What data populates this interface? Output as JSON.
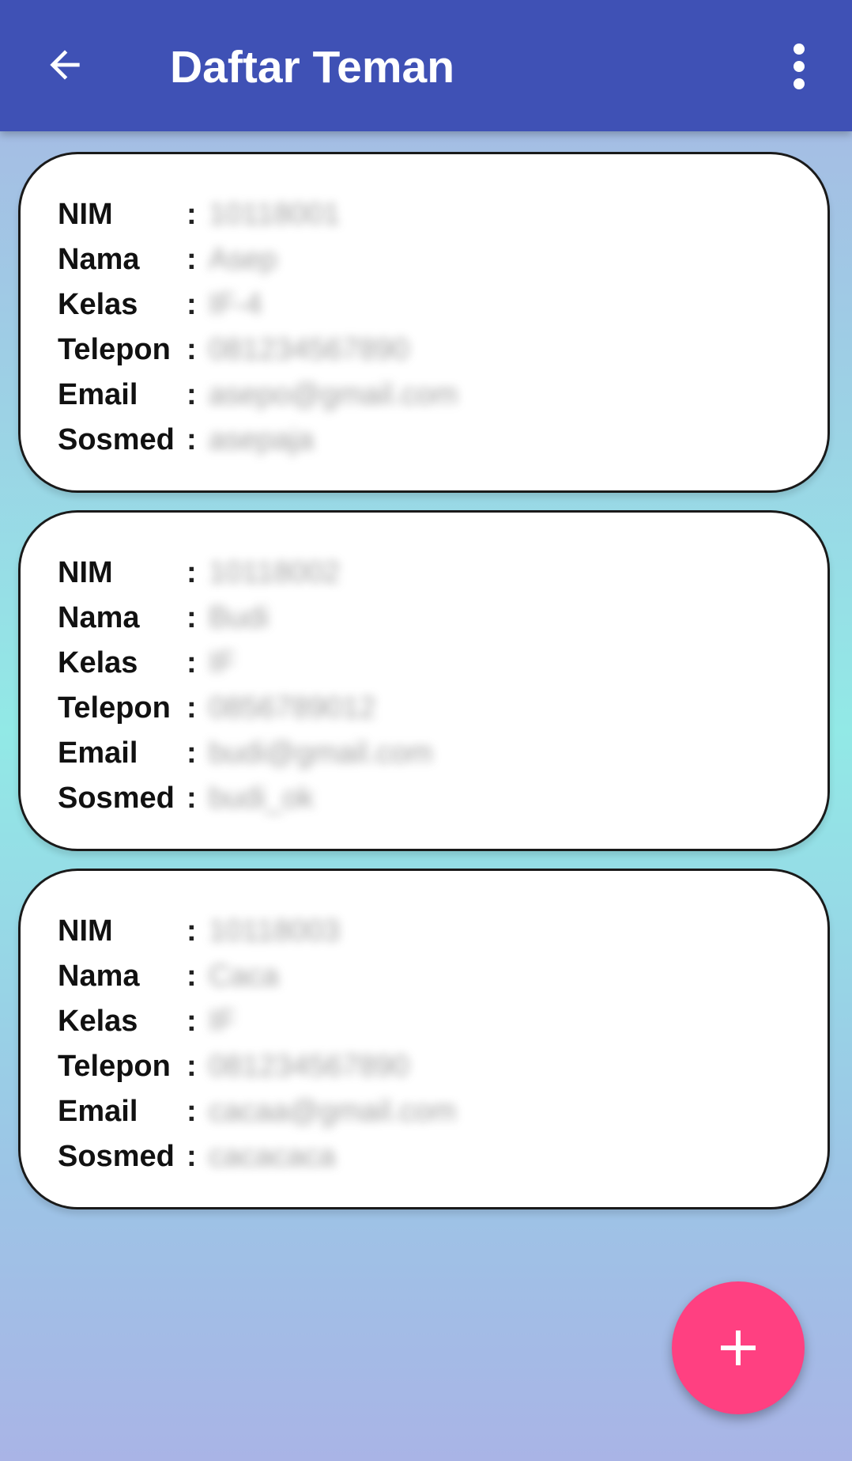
{
  "appbar": {
    "title": "Daftar Teman",
    "back_icon": "arrow-back-icon",
    "menu_icon": "more-vert-icon",
    "background": "#3f51b5"
  },
  "friends": [
    {
      "rows": [
        {
          "label": "NIM",
          "sep": ":",
          "value": "10118001"
        },
        {
          "label": "Nama",
          "sep": ":",
          "value": "Asep"
        },
        {
          "label": "Kelas",
          "sep": ":",
          "value": "IF-4"
        },
        {
          "label": "Telepon",
          "sep": ":",
          "value": "081234567890"
        },
        {
          "label": "Email",
          "sep": ":",
          "value": "asepo@gmail.com"
        },
        {
          "label": "Sosmed",
          "sep": ":",
          "value": "asepaja"
        }
      ]
    },
    {
      "rows": [
        {
          "label": "NIM",
          "sep": ":",
          "value": "10118002"
        },
        {
          "label": "Nama",
          "sep": ":",
          "value": "Budi"
        },
        {
          "label": "Kelas",
          "sep": ":",
          "value": "IF"
        },
        {
          "label": "Telepon",
          "sep": ":",
          "value": "0856789012"
        },
        {
          "label": "Email",
          "sep": ":",
          "value": "budi@gmail.com"
        },
        {
          "label": "Sosmed",
          "sep": ":",
          "value": "budi_ok"
        }
      ]
    },
    {
      "rows": [
        {
          "label": "NIM",
          "sep": ":",
          "value": "10118003"
        },
        {
          "label": "Nama",
          "sep": ":",
          "value": "Caca"
        },
        {
          "label": "Kelas",
          "sep": ":",
          "value": "IF"
        },
        {
          "label": "Telepon",
          "sep": ":",
          "value": "081234567890"
        },
        {
          "label": "Email",
          "sep": ":",
          "value": "cacaa@gmail.com"
        },
        {
          "label": "Sosmed",
          "sep": ":",
          "value": "cacacaca"
        }
      ]
    }
  ],
  "fab": {
    "icon": "plus-icon",
    "color": "#ff4081"
  }
}
